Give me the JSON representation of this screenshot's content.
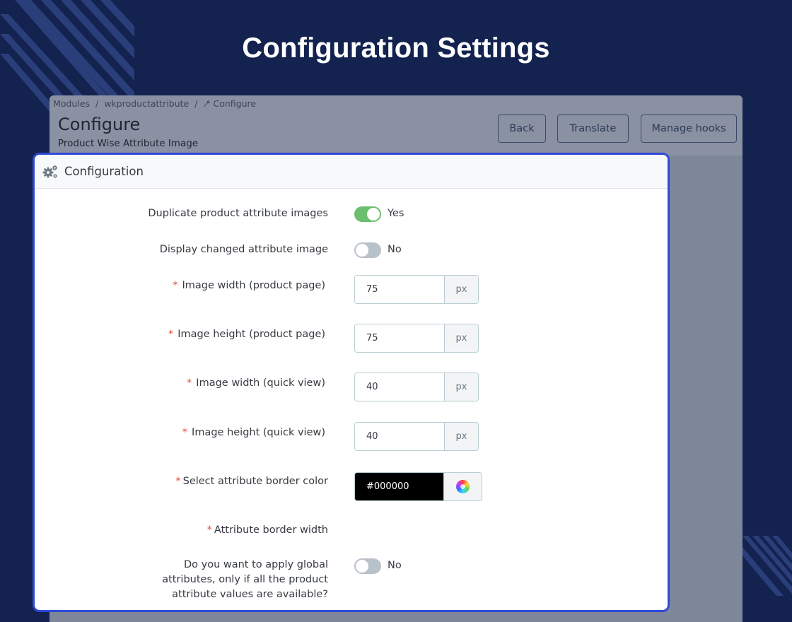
{
  "main_title": "Configuration Settings",
  "breadcrumb": {
    "items": [
      "Modules",
      "wkproductattribute",
      "Configure"
    ],
    "separator": "/"
  },
  "header": {
    "title": "Configure",
    "subtitle": "Product Wise Attribute Image",
    "buttons": {
      "back": "Back",
      "translate": "Translate",
      "manage_hooks": "Manage hooks"
    }
  },
  "panel": {
    "title": "Configuration",
    "icon": "gears-icon"
  },
  "form": {
    "duplicate_images": {
      "label": "Duplicate product attribute images",
      "enabled": true,
      "state_text": "Yes"
    },
    "display_changed": {
      "label": "Display changed attribute image",
      "enabled": false,
      "state_text": "No"
    },
    "image_width_product": {
      "required_mark": "*",
      "label": "Image width (product page)",
      "value": "75",
      "unit": "px"
    },
    "image_height_product": {
      "required_mark": "*",
      "label": "Image height (product page)",
      "value": "75",
      "unit": "px"
    },
    "image_width_quick": {
      "required_mark": "*",
      "label": "Image width (quick view)",
      "value": "40",
      "unit": "px"
    },
    "image_height_quick": {
      "required_mark": "*",
      "label": "Image height (quick view)",
      "value": "40",
      "unit": "px"
    },
    "border_color": {
      "required_mark": "*",
      "label": "Select attribute border color",
      "value": "#000000"
    },
    "border_width": {
      "required_mark": "*",
      "label": "Attribute border width"
    },
    "global_attributes": {
      "label_lines": [
        "Do you want to apply global",
        "attributes, only if all the product",
        "attribute values are available?"
      ],
      "enabled": false,
      "state_text": "No"
    }
  },
  "colors": {
    "background": "#13224f",
    "panel_border": "#2f4ad6",
    "toggle_on": "#6bbf6e",
    "toggle_off": "#b9c1cb",
    "required": "#e04d3a"
  }
}
